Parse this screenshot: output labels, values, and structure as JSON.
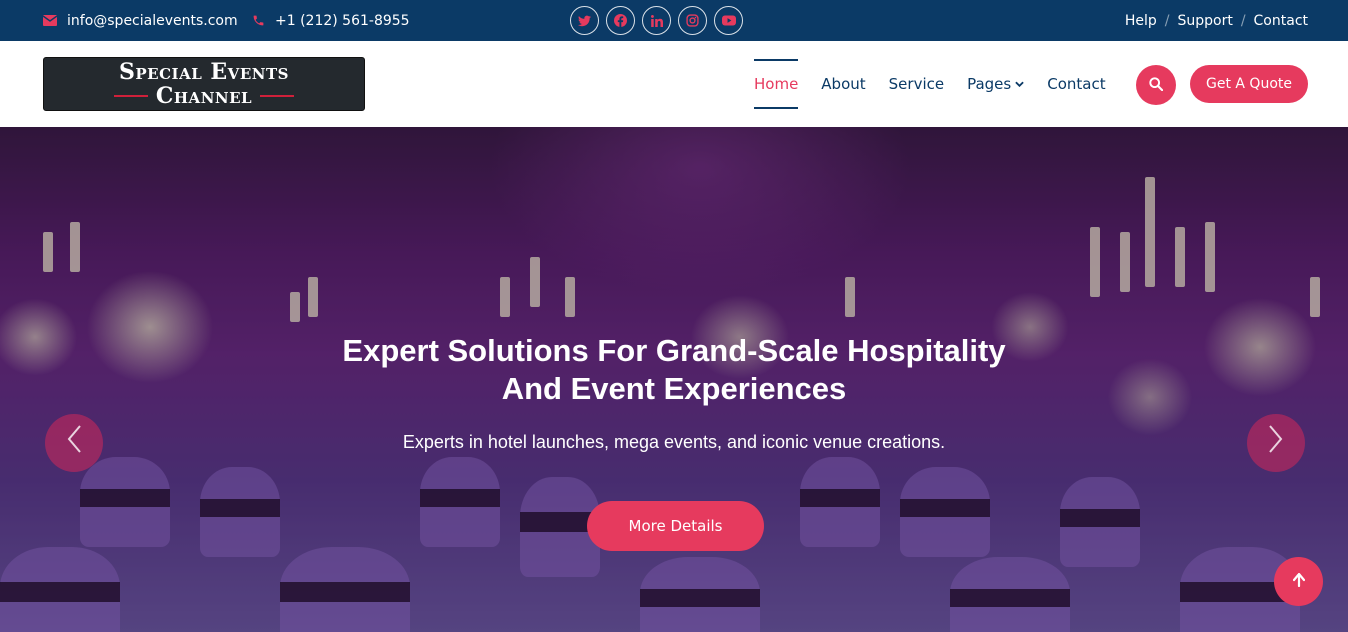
{
  "topbar": {
    "email": "info@specialevents.com",
    "phone": "+1 (212) 561-8955",
    "social": [
      "twitter-icon",
      "facebook-icon",
      "linkedin-icon",
      "instagram-icon",
      "youtube-icon"
    ],
    "links": [
      "Help",
      "Support",
      "Contact"
    ]
  },
  "logo": {
    "line1": "Special Events",
    "line2": "Channel"
  },
  "nav": {
    "items": [
      {
        "label": "Home",
        "active": true
      },
      {
        "label": "About"
      },
      {
        "label": "Service"
      },
      {
        "label": "Pages",
        "dropdown": true
      },
      {
        "label": "Contact"
      }
    ],
    "search_icon": "search-icon",
    "quote_label": "Get A Quote"
  },
  "hero": {
    "title_line1": "Expert Solutions For Grand-Scale Hospitality",
    "title_line2": "And Event Experiences",
    "subtitle": "Experts in hotel launches, mega events, and iconic venue creations.",
    "button_label": "More Details"
  },
  "colors": {
    "accent": "#e63a5e",
    "navy": "#0b3a66"
  }
}
